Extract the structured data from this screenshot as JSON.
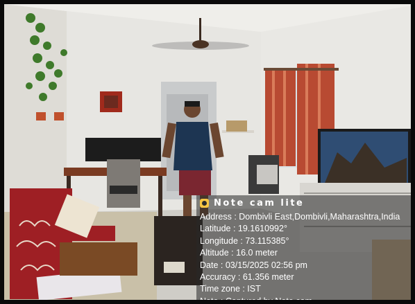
{
  "overlay": {
    "icon": "camera-icon",
    "app_name": "Note cam lite",
    "lines": [
      "Address : Dombivli East,Dombivli,Maharashtra,India",
      "Latitude : 19.1610992°",
      "Longitude : 73.115385°",
      "Altitude : 16.0 meter",
      "Date : 03/15/2025 02:56 pm",
      "Accuracy : 61.356 meter",
      "Time zone : IST",
      "Note : Captured by Note cam"
    ]
  },
  "colors": {
    "wall": "#e6e5e1",
    "curtain": "#b84a32",
    "sofa": "#c9c0a8",
    "throw": "#9e1f24",
    "shirt": "#1d3552",
    "shorts": "#7a2630"
  }
}
